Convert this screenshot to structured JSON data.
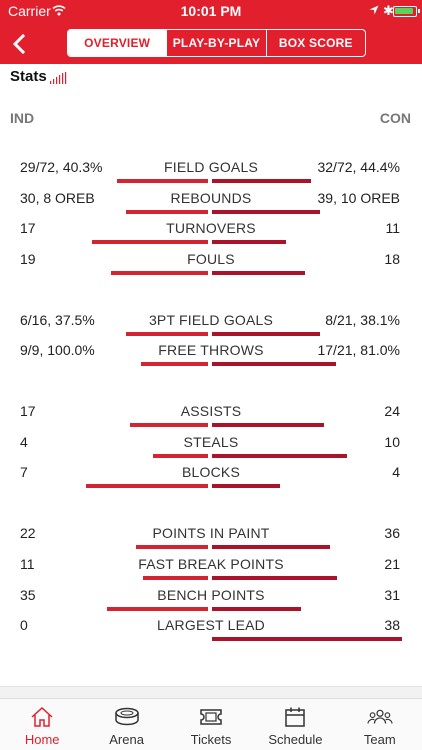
{
  "status_bar": {
    "carrier": "Carrier",
    "time": "10:01 PM"
  },
  "nav": {
    "tabs": [
      {
        "label": "OVERVIEW",
        "active": true
      },
      {
        "label": "PLAY-BY-PLAY",
        "active": false
      },
      {
        "label": "BOX SCORE",
        "active": false
      }
    ]
  },
  "colors": {
    "brand": "#e21f2d",
    "bar_left": "#d22433",
    "bar_right": "#a9142b"
  },
  "stats": {
    "title": "Stats",
    "team_left": "IND",
    "team_right": "CON",
    "rows": [
      {
        "label": "FIELD GOALS",
        "left": "29/72, 40.3%",
        "right": "32/72, 44.4%",
        "left_share": 0.48,
        "right_share": 0.52
      },
      {
        "label": "REBOUNDS",
        "left": "30, 8 OREB",
        "right": "39, 10 OREB",
        "left_share": 0.43,
        "right_share": 0.57
      },
      {
        "label": "TURNOVERS",
        "left": "17",
        "right": "11",
        "left_share": 0.61,
        "right_share": 0.39
      },
      {
        "label": "FOULS",
        "left": "19",
        "right": "18",
        "left_share": 0.51,
        "right_share": 0.49
      },
      {
        "label": "3PT FIELD GOALS",
        "left": "6/16, 37.5%",
        "right": "8/21, 38.1%",
        "left_share": 0.43,
        "right_share": 0.57
      },
      {
        "label": "FREE THROWS",
        "left": "9/9, 100.0%",
        "right": "17/21, 81.0%",
        "left_share": 0.35,
        "right_share": 0.65
      },
      {
        "label": "ASSISTS",
        "left": "17",
        "right": "24",
        "left_share": 0.41,
        "right_share": 0.59
      },
      {
        "label": "STEALS",
        "left": "4",
        "right": "10",
        "left_share": 0.29,
        "right_share": 0.71
      },
      {
        "label": "BLOCKS",
        "left": "7",
        "right": "4",
        "left_share": 0.64,
        "right_share": 0.36
      },
      {
        "label": "POINTS IN PAINT",
        "left": "22",
        "right": "36",
        "left_share": 0.38,
        "right_share": 0.62
      },
      {
        "label": "FAST BREAK POINTS",
        "left": "11",
        "right": "21",
        "left_share": 0.34,
        "right_share": 0.66
      },
      {
        "label": "BENCH POINTS",
        "left": "35",
        "right": "31",
        "left_share": 0.53,
        "right_share": 0.47
      },
      {
        "label": "LARGEST LEAD",
        "left": "0",
        "right": "38",
        "left_share": 0.0,
        "right_share": 1.0
      }
    ]
  },
  "tab_bar": {
    "items": [
      {
        "label": "Home",
        "icon": "home-icon",
        "active": true
      },
      {
        "label": "Arena",
        "icon": "arena-icon",
        "active": false
      },
      {
        "label": "Tickets",
        "icon": "ticket-icon",
        "active": false
      },
      {
        "label": "Schedule",
        "icon": "calendar-icon",
        "active": false
      },
      {
        "label": "Team",
        "icon": "team-icon",
        "active": false
      }
    ]
  }
}
